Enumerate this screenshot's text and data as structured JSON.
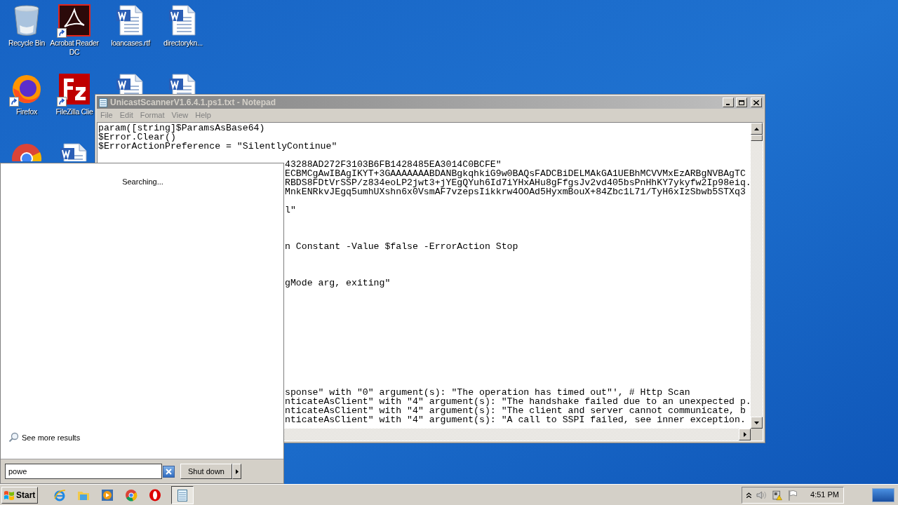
{
  "desktop_icons": [
    {
      "kind": "recycle",
      "label": "Recycle Bin",
      "shortcut": false
    },
    {
      "kind": "acrobat",
      "label": "Acrobat Reader DC",
      "shortcut": true
    },
    {
      "kind": "word",
      "label": "loancases.rtf",
      "shortcut": false
    },
    {
      "kind": "word",
      "label": "directorykn...",
      "shortcut": false
    },
    {
      "kind": "firefox",
      "label": "Firefox",
      "shortcut": true
    },
    {
      "kind": "filezilla",
      "label": "FileZilla Clie",
      "shortcut": true
    },
    {
      "kind": "word"
    },
    {
      "kind": "word"
    },
    {
      "kind": "chrome",
      "shortcut": false
    },
    {
      "kind": "word",
      "shortcut": false
    }
  ],
  "notepad": {
    "title": "UnicastScannerV1.6.4.1.ps1.txt - Notepad",
    "active": false,
    "menu": [
      "File",
      "Edit",
      "Format",
      "View",
      "Help"
    ],
    "lines": [
      {
        "kind": "full",
        "text": "param([string]$ParamsAsBase64)"
      },
      {
        "kind": "full",
        "text": "$Error.Clear()"
      },
      {
        "kind": "full",
        "text": "$ErrorActionPreference = \"SilentlyContinue\""
      },
      {
        "kind": "blank"
      },
      {
        "kind": "partial",
        "text": "43288AD272F3103B6FB1428485EA3014C0BCFE\""
      },
      {
        "kind": "partial",
        "text": "ECBMCgAwIBAgIKYT+3GAAAAAAABDANBgkqhkiG9w0BAQsFADCBiDELMAkGA1UEBhMCVVMxEzARBgNVBAgTC"
      },
      {
        "kind": "partial",
        "text": "RBDS8FDtVrSSP/z834eoLP2jwt3+jYEgQYuh6Id7iYHxAHu8gFfgsJv2vd405bsPnHhKY7ykyfw2Ip98eiq."
      },
      {
        "kind": "partial",
        "text": "MnkENRkvJEgq5umhUXshn6x0VsmAF7vzepsIikkrw4OOAd5HyxmBouX+84Zbc1L71/TyH6xIzSbwb5STXq3"
      },
      {
        "kind": "blank"
      },
      {
        "kind": "partial",
        "text": "l\""
      },
      {
        "kind": "blank"
      },
      {
        "kind": "blank"
      },
      {
        "kind": "blank"
      },
      {
        "kind": "partial",
        "text": "n Constant -Value $false -ErrorAction Stop"
      },
      {
        "kind": "blank"
      },
      {
        "kind": "blank"
      },
      {
        "kind": "blank"
      },
      {
        "kind": "partial",
        "text": "gMode arg, exiting\""
      },
      {
        "kind": "blank"
      },
      {
        "kind": "blank"
      },
      {
        "kind": "blank"
      },
      {
        "kind": "blank"
      },
      {
        "kind": "blank"
      },
      {
        "kind": "blank"
      },
      {
        "kind": "blank"
      },
      {
        "kind": "blank"
      },
      {
        "kind": "blank"
      },
      {
        "kind": "blank"
      },
      {
        "kind": "blank"
      },
      {
        "kind": "partial",
        "text": "sponse\" with \"0\" argument(s): \"The operation has timed out\"', # Http Scan"
      },
      {
        "kind": "partial",
        "text": "nticateAsClient\" with \"4\" argument(s): \"The handshake failed due to an unexpected p."
      },
      {
        "kind": "partial",
        "text": "nticateAsClient\" with \"4\" argument(s): \"The client and server cannot communicate, b"
      },
      {
        "kind": "partial",
        "text": "nticateAsClient\" with \"4\" argument(s): \"A call to SSPI failed, see inner exception."
      }
    ]
  },
  "start_menu": {
    "status": "Searching...",
    "more_results": "See more results",
    "search": {
      "value": "powe"
    },
    "shutdown": "Shut down"
  },
  "taskbar": {
    "start": "Start",
    "apps": [
      {
        "kind": "ie",
        "active": false
      },
      {
        "kind": "explorer",
        "active": false
      },
      {
        "kind": "media",
        "active": false
      },
      {
        "kind": "chrome",
        "active": false
      },
      {
        "kind": "opera",
        "active": false
      },
      {
        "kind": "notepad",
        "active": true
      }
    ],
    "clock": "4:51 PM"
  }
}
